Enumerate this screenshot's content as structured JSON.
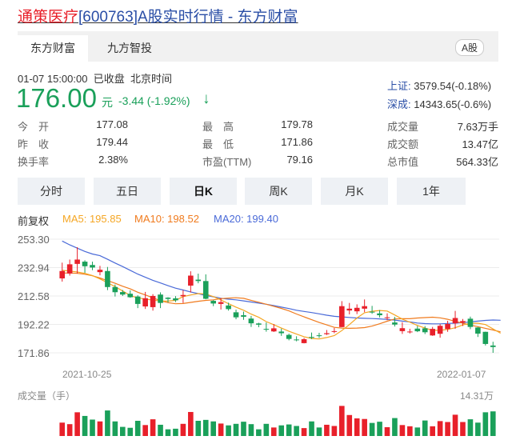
{
  "title": {
    "name": "通策医疗",
    "code": "[600763]",
    "suffix": "A股实时行情 - 东方财富"
  },
  "tabs": [
    {
      "label": "东方财富",
      "active": true
    },
    {
      "label": "九方智投",
      "active": false
    }
  ],
  "market_badge": "A股",
  "status": {
    "time": "01-07 15:00:00",
    "state": "已收盘",
    "tz": "北京时间"
  },
  "price": {
    "current": "176.00",
    "unit": "元",
    "change": "-3.44 (-1.92%)",
    "arrow": "↓"
  },
  "indices": [
    {
      "name": "上证:",
      "value": "3579.54(-0.18%)"
    },
    {
      "name": "深成:",
      "value": "14343.65(-0.6%)"
    }
  ],
  "stats": {
    "col1": [
      {
        "label": "今　开",
        "value": "177.08",
        "color": "green"
      },
      {
        "label": "昨　收",
        "value": "179.44",
        "color": "normal"
      },
      {
        "label": "换手率",
        "value": "2.38%",
        "color": "normal"
      }
    ],
    "col2": [
      {
        "label": "最　高",
        "value": "179.78",
        "color": "red"
      },
      {
        "label": "最　低",
        "value": "171.86",
        "color": "green"
      },
      {
        "label": "市盈(TTM)",
        "value": "79.16",
        "color": "normal"
      }
    ],
    "col3": [
      {
        "label": "成交量",
        "value": "7.63万手",
        "color": "normal"
      },
      {
        "label": "成交额",
        "value": "13.47亿",
        "color": "normal"
      },
      {
        "label": "总市值",
        "value": "564.33亿",
        "color": "normal"
      }
    ]
  },
  "periods": [
    {
      "label": "分时",
      "active": false
    },
    {
      "label": "五日",
      "active": false
    },
    {
      "label": "日K",
      "active": true
    },
    {
      "label": "周K",
      "active": false
    },
    {
      "label": "月K",
      "active": false
    },
    {
      "label": "1年",
      "active": false
    }
  ],
  "ma_legend": {
    "adjust": "前复权",
    "ma5": "MA5: 195.85",
    "ma10": "MA10: 198.52",
    "ma20": "MA20: 199.40"
  },
  "colors": {
    "up": "#e8202a",
    "down": "#1aa05a",
    "ma5": "#f5a623",
    "ma10": "#f07b1e",
    "ma20": "#4a6ad8"
  },
  "chart_data": {
    "type": "candlestick",
    "y_ticks": [
      "253.30",
      "232.94",
      "212.58",
      "192.22",
      "171.86"
    ],
    "ylim": [
      171.86,
      253.3
    ],
    "x_start_label": "2021-10-25",
    "x_end_label": "2022-01-07",
    "volume_label": "成交量（手）",
    "volume_max_label": "14.31万",
    "candles": [
      {
        "o": 225.2,
        "h": 236.5,
        "l": 222.9,
        "c": 230.5
      },
      {
        "o": 228.7,
        "h": 238.7,
        "l": 227.2,
        "c": 235.3
      },
      {
        "o": 235.6,
        "h": 247.6,
        "l": 228.7,
        "c": 238.7
      },
      {
        "o": 237.2,
        "h": 238.2,
        "l": 229.2,
        "c": 233.9
      },
      {
        "o": 234.8,
        "h": 237.2,
        "l": 231.1,
        "c": 233.0
      },
      {
        "o": 229.7,
        "h": 234.2,
        "l": 227.4,
        "c": 231.4
      },
      {
        "o": 230.5,
        "h": 233.4,
        "l": 216.8,
        "c": 219.0
      },
      {
        "o": 219.0,
        "h": 220.8,
        "l": 212.2,
        "c": 215.3
      },
      {
        "o": 215.4,
        "h": 216.9,
        "l": 212.6,
        "c": 213.6
      },
      {
        "o": 214.2,
        "h": 216.6,
        "l": 211.3,
        "c": 211.7
      },
      {
        "o": 212.2,
        "h": 213.1,
        "l": 203.9,
        "c": 206.9
      },
      {
        "o": 205.1,
        "h": 215.5,
        "l": 203.3,
        "c": 211.0
      },
      {
        "o": 204.6,
        "h": 213.9,
        "l": 202.1,
        "c": 212.6
      },
      {
        "o": 213.6,
        "h": 215.2,
        "l": 203.9,
        "c": 207.6
      },
      {
        "o": 211.4,
        "h": 211.7,
        "l": 208.0,
        "c": 210.5
      },
      {
        "o": 210.9,
        "h": 212.5,
        "l": 208.2,
        "c": 209.5
      },
      {
        "o": 212.4,
        "h": 216.8,
        "l": 207.6,
        "c": 213.3
      },
      {
        "o": 220.0,
        "h": 230.3,
        "l": 215.1,
        "c": 227.2
      },
      {
        "o": 224.3,
        "h": 228.6,
        "l": 221.7,
        "c": 223.3
      },
      {
        "o": 223.3,
        "h": 228.1,
        "l": 210.2,
        "c": 210.6
      },
      {
        "o": 209.1,
        "h": 209.6,
        "l": 205.3,
        "c": 207.2
      },
      {
        "o": 206.9,
        "h": 211.1,
        "l": 202.9,
        "c": 208.2
      },
      {
        "o": 205.8,
        "h": 207.8,
        "l": 202.1,
        "c": 203.2
      },
      {
        "o": 200.9,
        "h": 202.8,
        "l": 195.9,
        "c": 197.3
      },
      {
        "o": 198.8,
        "h": 201.4,
        "l": 195.5,
        "c": 197.7
      },
      {
        "o": 196.4,
        "h": 198.3,
        "l": 190.4,
        "c": 193.0
      },
      {
        "o": 192.9,
        "h": 193.4,
        "l": 190.2,
        "c": 192.0
      },
      {
        "o": 189.0,
        "h": 193.6,
        "l": 187.0,
        "c": 188.6
      },
      {
        "o": 187.2,
        "h": 192.5,
        "l": 186.8,
        "c": 189.4
      },
      {
        "o": 187.1,
        "h": 189.2,
        "l": 184.0,
        "c": 185.9
      },
      {
        "o": 184.7,
        "h": 185.6,
        "l": 180.8,
        "c": 181.8
      },
      {
        "o": 181.4,
        "h": 183.7,
        "l": 180.1,
        "c": 181.0
      },
      {
        "o": 178.8,
        "h": 182.5,
        "l": 178.6,
        "c": 181.6
      },
      {
        "o": 183.2,
        "h": 186.4,
        "l": 181.7,
        "c": 182.6
      },
      {
        "o": 184.4,
        "h": 186.2,
        "l": 182.5,
        "c": 184.1
      },
      {
        "o": 185.2,
        "h": 188.2,
        "l": 184.6,
        "c": 185.9
      },
      {
        "o": 186.9,
        "h": 189.7,
        "l": 185.9,
        "c": 187.4
      },
      {
        "o": 190.3,
        "h": 208.9,
        "l": 190.3,
        "c": 205.3
      },
      {
        "o": 202.2,
        "h": 207.6,
        "l": 199.4,
        "c": 203.5
      },
      {
        "o": 201.6,
        "h": 206.6,
        "l": 199.6,
        "c": 204.1
      },
      {
        "o": 203.5,
        "h": 210.1,
        "l": 201.0,
        "c": 205.3
      },
      {
        "o": 201.3,
        "h": 205.5,
        "l": 199.8,
        "c": 201.1
      },
      {
        "o": 200.1,
        "h": 202.5,
        "l": 197.2,
        "c": 198.8
      },
      {
        "o": 196.9,
        "h": 200.2,
        "l": 195.2,
        "c": 197.3
      },
      {
        "o": 193.6,
        "h": 197.6,
        "l": 190.7,
        "c": 192.1
      },
      {
        "o": 187.4,
        "h": 193.8,
        "l": 185.4,
        "c": 189.5
      },
      {
        "o": 186.6,
        "h": 189.1,
        "l": 185.7,
        "c": 187.1
      },
      {
        "o": 189.2,
        "h": 191.1,
        "l": 186.7,
        "c": 187.3
      },
      {
        "o": 189.4,
        "h": 191.0,
        "l": 185.3,
        "c": 186.6
      },
      {
        "o": 184.3,
        "h": 190.4,
        "l": 184.0,
        "c": 189.0
      },
      {
        "o": 185.5,
        "h": 192.4,
        "l": 182.7,
        "c": 191.2
      },
      {
        "o": 188.9,
        "h": 194.8,
        "l": 186.9,
        "c": 192.5
      },
      {
        "o": 193.0,
        "h": 201.9,
        "l": 189.1,
        "c": 196.8
      },
      {
        "o": 193.5,
        "h": 196.1,
        "l": 191.1,
        "c": 194.6
      },
      {
        "o": 196.3,
        "h": 197.8,
        "l": 188.8,
        "c": 190.4
      },
      {
        "o": 190.0,
        "h": 190.4,
        "l": 183.2,
        "c": 185.6
      },
      {
        "o": 186.9,
        "h": 187.0,
        "l": 177.1,
        "c": 178.2
      },
      {
        "o": 177.08,
        "h": 179.78,
        "l": 171.86,
        "c": 176.0
      }
    ],
    "ma5": [
      231.0,
      230.5,
      229.8,
      228.8,
      227.2,
      224.8,
      222.1,
      219.3,
      216.2,
      212.9,
      211.2,
      210.4,
      209.6,
      209.0,
      208.9,
      209.5,
      212.1,
      213.3,
      214.3,
      214.0,
      212.1,
      209.8,
      207.1,
      204.6,
      202.4,
      199.6,
      197.3,
      194.2,
      192.0,
      189.6,
      187.3,
      185.3,
      183.4,
      182.1,
      181.8,
      182.8,
      184.2,
      187.8,
      192.1,
      196.8,
      200.6,
      201.6,
      202.2,
      201.8,
      199.0,
      196.0,
      193.8,
      191.5,
      189.6,
      188.0,
      188.0,
      188.6,
      189.8,
      191.8,
      193.0,
      193.1,
      192.1,
      189.0,
      185.9
    ],
    "ma10": [
      229.0,
      229.1,
      228.8,
      228.2,
      227.1,
      225.5,
      223.6,
      221.7,
      219.6,
      217.7,
      215.3,
      213.3,
      211.3,
      209.2,
      207.8,
      207.0,
      207.2,
      208.0,
      208.8,
      209.4,
      209.8,
      210.7,
      211.1,
      211.3,
      210.9,
      209.5,
      208.1,
      206.7,
      205.2,
      203.7,
      201.9,
      199.7,
      197.6,
      195.6,
      193.6,
      191.9,
      190.1,
      189.6,
      189.4,
      189.6,
      189.9,
      191.0,
      192.7,
      194.5,
      196.1,
      196.3,
      196.3,
      196.8,
      197.1,
      197.4,
      196.9,
      195.9,
      194.4,
      193.1,
      191.7,
      190.6,
      189.4,
      188.2,
      186.9
    ],
    "ma20": [
      252.0,
      249.2,
      246.9,
      244.5,
      242.7,
      241.5,
      238.9,
      236.2,
      233.7,
      231.0,
      228.3,
      226.0,
      223.8,
      221.9,
      220.0,
      218.2,
      216.9,
      215.5,
      214.3,
      212.9,
      212.0,
      211.0,
      210.3,
      209.8,
      209.1,
      208.3,
      207.5,
      206.7,
      205.7,
      204.6,
      203.6,
      202.4,
      201.5,
      200.7,
      199.8,
      198.8,
      198.0,
      197.6,
      197.2,
      196.8,
      196.6,
      196.4,
      196.2,
      195.8,
      195.3,
      194.6,
      194.0,
      193.2,
      192.8,
      192.6,
      192.6,
      192.9,
      193.1,
      193.5,
      194.0,
      194.6,
      195.1,
      195.4,
      195.2
    ],
    "volumes": [
      0.44,
      0.39,
      0.78,
      0.66,
      0.54,
      0.48,
      0.84,
      0.48,
      0.3,
      0.27,
      0.5,
      0.36,
      0.55,
      0.37,
      0.22,
      0.24,
      0.4,
      0.79,
      0.5,
      0.53,
      0.48,
      0.41,
      0.35,
      0.4,
      0.47,
      0.39,
      0.22,
      0.4,
      0.28,
      0.35,
      0.38,
      0.33,
      0.26,
      0.48,
      0.28,
      0.37,
      0.33,
      0.99,
      0.69,
      0.58,
      0.56,
      0.43,
      0.47,
      0.29,
      0.59,
      0.36,
      0.32,
      0.28,
      0.51,
      0.32,
      0.49,
      0.46,
      0.7,
      0.46,
      0.55,
      0.44,
      0.78,
      0.81
    ]
  }
}
